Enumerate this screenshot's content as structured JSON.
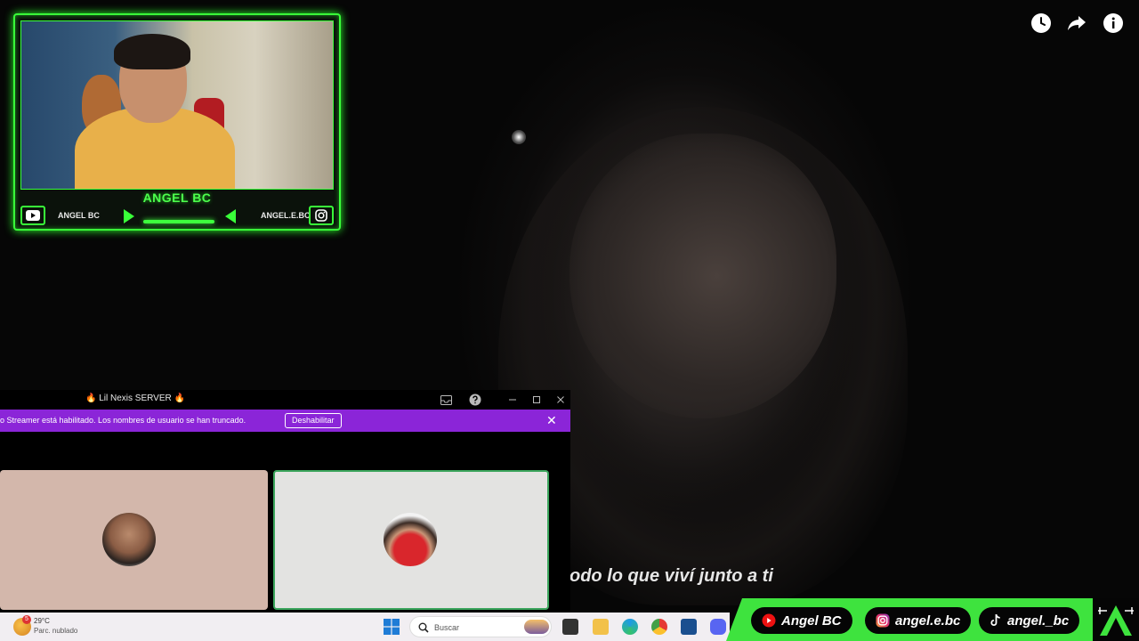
{
  "video": {
    "subtitle": "odo lo que viví junto a ti",
    "icons": [
      "clock-icon",
      "share-icon",
      "info-icon"
    ]
  },
  "webcam": {
    "name": "ANGEL BC",
    "youtube_handle": "ANGEL BC",
    "instagram_handle": "ANGEL.E.BC",
    "accent": "#39ff39"
  },
  "discord": {
    "server_name": "🔥 Lil Nexis SERVER 🔥",
    "banner_text": "o Streamer está habilitado. Los nombres de usuario se han truncado.",
    "banner_button": "Deshabilitar",
    "banner_color": "#8b25d8",
    "close_glyph": "✕",
    "controls": [
      "inbox-icon",
      "help-icon",
      "minimize-icon",
      "maximize-icon",
      "close-icon"
    ]
  },
  "taskbar": {
    "weather_badge": "5",
    "temperature": "29°C",
    "weather_desc": "Parc. nublado",
    "search_placeholder": "Buscar"
  },
  "social": {
    "youtube": "Angel BC",
    "instagram": "angel.e.bc",
    "tiktok": "angel._bc",
    "bar_color": "#3ee33e"
  }
}
